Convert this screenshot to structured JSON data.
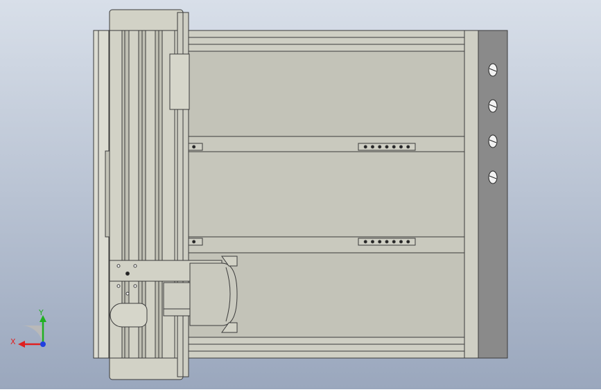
{
  "viewport": {
    "background_top": "#d8dfe9",
    "background_bottom": "#9aa7bd"
  },
  "model": {
    "plate_color": "#c3c3b8",
    "rail_color": "#d2d2c6",
    "edge_color": "#3a3a3a",
    "side_bar_color": "#8a8a8a",
    "slot_count": 4,
    "hole_row_count": 7
  },
  "triad": {
    "x_label": "X",
    "y_label": "Y",
    "x_color": "#e02020",
    "y_color": "#20b020",
    "z_color": "#2040e0"
  }
}
